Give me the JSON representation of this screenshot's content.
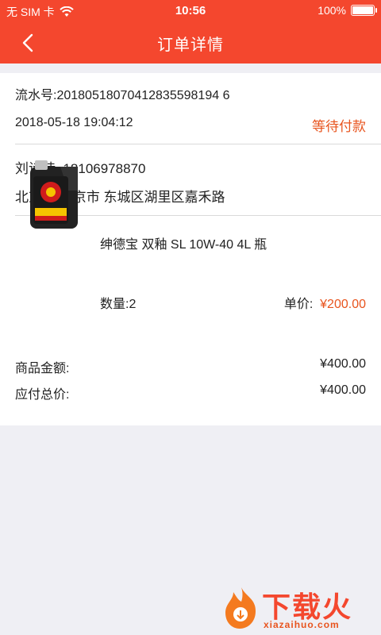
{
  "status_bar": {
    "carrier": "无 SIM 卡",
    "time": "10:56",
    "battery": "100%",
    "battery_level": 1.0
  },
  "nav": {
    "title": "订单详情"
  },
  "order": {
    "serial_label": "流水号:",
    "serial_number": "20180518070412835598194 6",
    "datetime": "2018-05-18 19:04:12",
    "status": "等待付款"
  },
  "contact": {
    "name": "刘诗诗",
    "phone": "18106978870",
    "address": "北京市 北京市 东城区湖里区嘉禾路"
  },
  "product": {
    "name": "绅德宝 双釉 SL 10W-40 4L 瓶",
    "quantity": "数量:2",
    "unit_price_label": "单价:",
    "unit_price": "¥200.00"
  },
  "summary": {
    "goods_amount_label": "商品金额:",
    "goods_amount": "¥400.00",
    "total_label": "应付总价:",
    "total": "¥400.00"
  },
  "watermark": {
    "text": "下载火",
    "domain": "xiazaihuo.com"
  },
  "colors": {
    "brand": "#f4472e",
    "status": "#e8541e"
  }
}
